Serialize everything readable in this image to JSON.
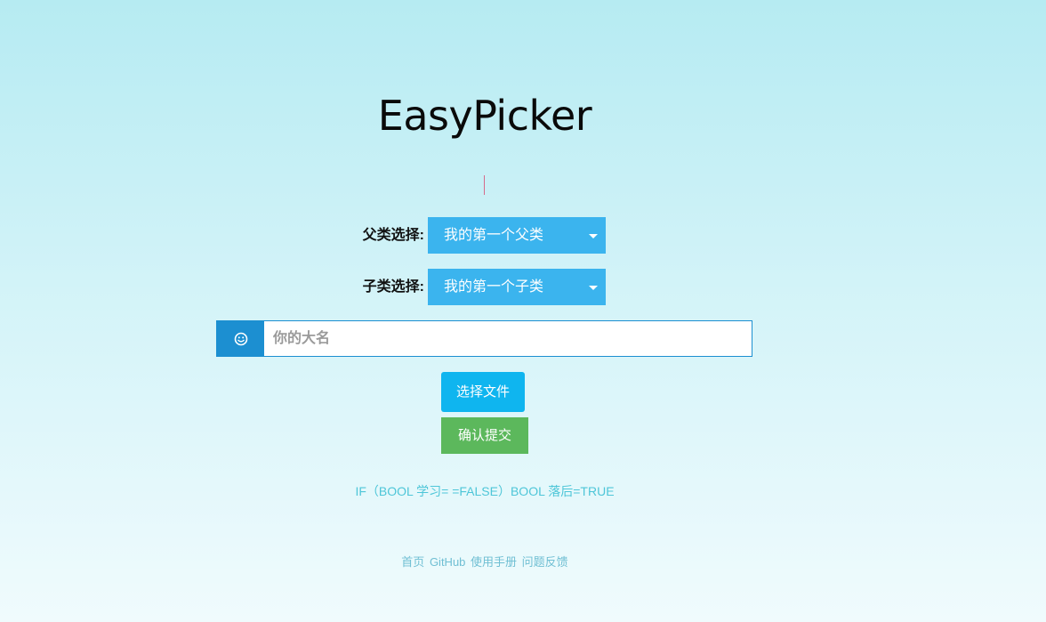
{
  "header": {
    "title": "EasyPicker"
  },
  "form": {
    "parent": {
      "label": "父类选择:",
      "selected": "我的第一个父类"
    },
    "child": {
      "label": "子类选择:",
      "selected": "我的第一个子类"
    },
    "name": {
      "icon": "smile-icon",
      "placeholder": "你的大名",
      "value": ""
    },
    "choose_file_label": "选择文件",
    "submit_label": "确认提交"
  },
  "motto": "IF（BOOL 学习= =FALSE）BOOL 落后=TRUE",
  "footer": {
    "links": [
      "首页",
      "GitHub",
      "使用手册",
      "问题反馈"
    ]
  },
  "colors": {
    "select_bg": "#3bb4ee",
    "addon_bg": "#1c8fd1",
    "choose_btn": "#0fb5ef",
    "submit_btn": "#5cb85c",
    "motto_text": "#4ec6d8",
    "footer_link": "#6fbfd3"
  }
}
